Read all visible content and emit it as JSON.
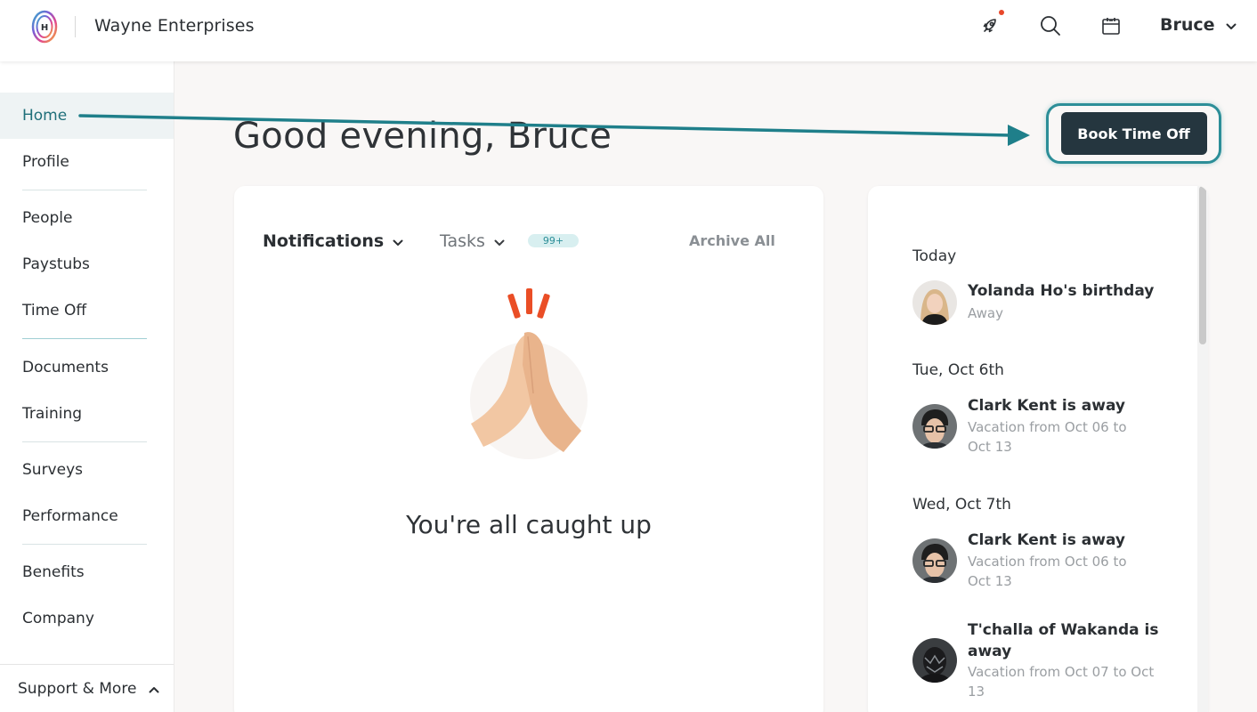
{
  "header": {
    "brand": "Wayne Enterprises",
    "user_name": "Bruce",
    "icons": [
      "rocket-icon",
      "search-icon",
      "calendar-icon",
      "chevron-down-icon"
    ],
    "notification_dot_color": "#e8472a"
  },
  "sidebar": {
    "items": [
      {
        "label": "Home",
        "active": true
      },
      {
        "label": "Profile"
      },
      {
        "label": "People"
      },
      {
        "label": "Paystubs"
      },
      {
        "label": "Time Off"
      },
      {
        "label": "Documents"
      },
      {
        "label": "Training"
      },
      {
        "label": "Surveys"
      },
      {
        "label": "Performance"
      },
      {
        "label": "Benefits"
      },
      {
        "label": "Company"
      }
    ],
    "support_label": "Support & More"
  },
  "main": {
    "greeting": "Good evening, Bruce",
    "book_time_off": "Book Time Off",
    "accent_color": "#2c8e98",
    "button_color": "#25363f"
  },
  "notifications_card": {
    "tab_notifications": "Notifications",
    "tab_tasks": "Tasks",
    "tasks_badge": "99+",
    "archive_all": "Archive All",
    "empty_message": "You're all caught up"
  },
  "events_card": {
    "groups": [
      {
        "day": "Today",
        "events": [
          {
            "title": "Yolanda Ho's birthday",
            "subtitle": "Away"
          }
        ]
      },
      {
        "day": "Tue, Oct 6th",
        "events": [
          {
            "title": "Clark Kent is away",
            "subtitle_line1": "Vacation from Oct 06 to",
            "subtitle_line2": "Oct 13"
          }
        ]
      },
      {
        "day": "Wed, Oct 7th",
        "events": [
          {
            "title": "Clark Kent is away",
            "subtitle_line1": "Vacation from Oct 06 to",
            "subtitle_line2": "Oct 13"
          },
          {
            "title_line1": "T'challa of Wakanda is",
            "title_line2": "away",
            "subtitle_line1": "Vacation from Oct 07 to Oct",
            "subtitle_line2": "13"
          }
        ]
      }
    ]
  }
}
